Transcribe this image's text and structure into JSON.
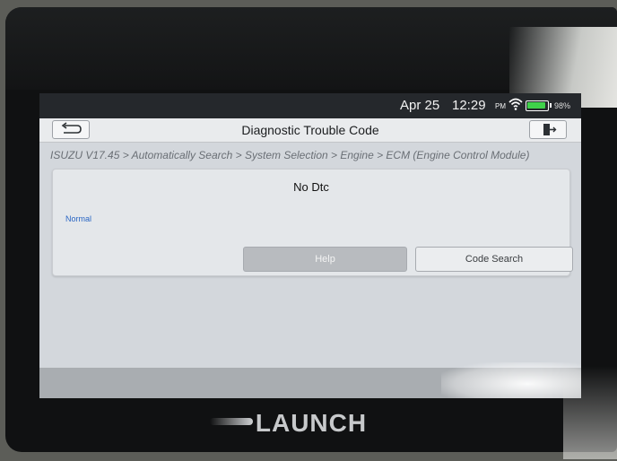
{
  "status_bar": {
    "date": "Apr 25",
    "time": "12:29",
    "ampm": "PM",
    "battery_percent": "98%",
    "battery_level": 0.98,
    "wifi_icon": "wifi-icon",
    "battery_icon": "battery-icon"
  },
  "app_bar": {
    "title": "Diagnostic Trouble Code",
    "back_icon": "back-arrow-icon",
    "exit_icon": "exit-icon"
  },
  "breadcrumb": "ISUZU V17.45 > Automatically Search > System Selection > Engine > ECM (Engine Control Module)",
  "panel": {
    "heading": "No Dtc",
    "status": "Normal",
    "help_label": "Help",
    "code_search_label": "Code Search"
  },
  "device": {
    "brand": "LAUNCH"
  },
  "colors": {
    "status_bar_bg": "#25282c",
    "screen_bg": "#d3d7dc",
    "link_blue": "#2a66c4",
    "battery_green": "#3fd14a"
  }
}
